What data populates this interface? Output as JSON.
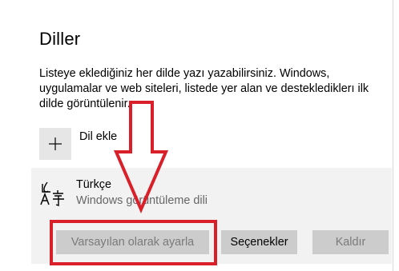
{
  "page": {
    "title": "Diller",
    "description": "Listeye eklediğiniz her dilde yazı yazabilirsiniz. Windows, uygulamalar ve web siteleri, listede yer alan ve desteklediklerı ilk dilde görüntülenir."
  },
  "add_language": {
    "label": "Dil ekle",
    "icon": "plus-icon"
  },
  "languages": [
    {
      "name": "Türkçe",
      "subtitle": "Windows görüntüleme dili",
      "icon": "language-icon",
      "buttons": {
        "set_default": "Varsayılan olarak ayarla",
        "options": "Seçenekler",
        "remove": "Kaldır"
      },
      "set_default_enabled": false,
      "options_enabled": true,
      "remove_enabled": false
    }
  ],
  "annotation": {
    "color": "#d9202a",
    "shapes": [
      "down-arrow",
      "highlight-box"
    ]
  }
}
